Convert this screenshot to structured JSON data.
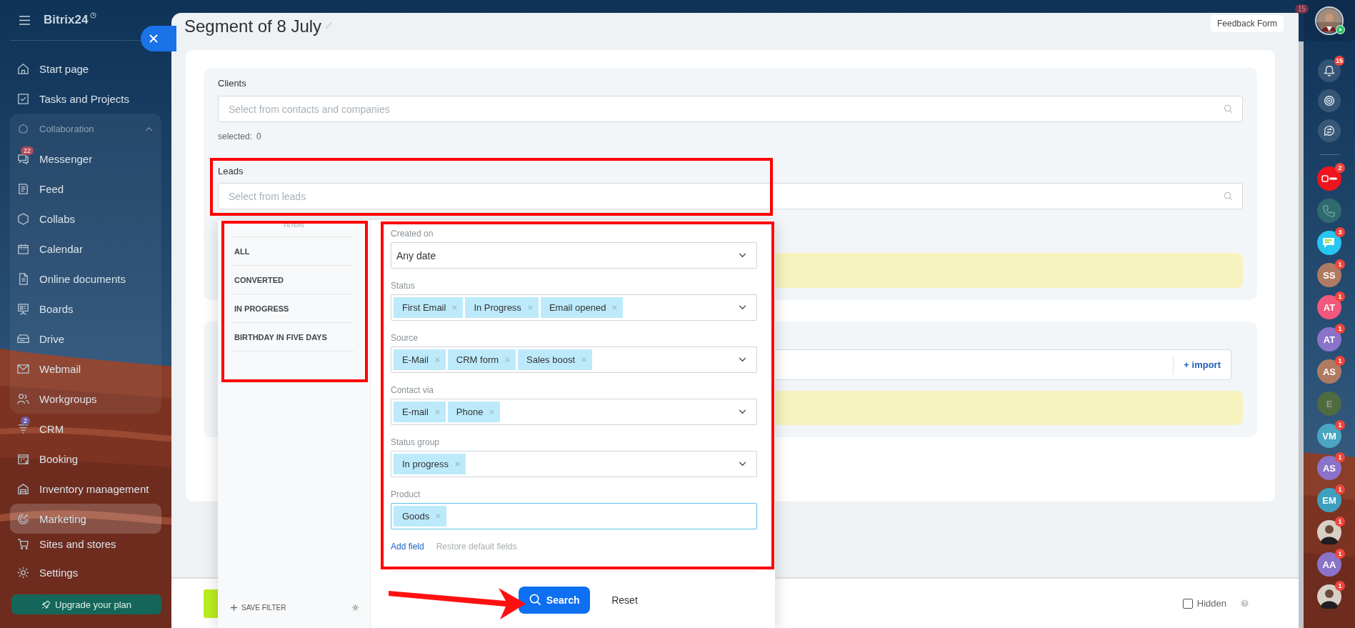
{
  "sidebar": {
    "logo": "Bitrix24",
    "items": [
      {
        "label": "Start page",
        "selected": false
      },
      {
        "label": "Tasks and Projects",
        "selected": false
      },
      {
        "label": "Collaboration",
        "selected": false,
        "expanded": true,
        "children": [
          {
            "label": "Messenger",
            "badge": "22",
            "selected": false
          },
          {
            "label": "Feed",
            "selected": false
          },
          {
            "label": "Collabs",
            "selected": false
          },
          {
            "label": "Calendar",
            "selected": false
          },
          {
            "label": "Online documents",
            "selected": false
          },
          {
            "label": "Boards",
            "selected": false
          },
          {
            "label": "Drive",
            "selected": false
          },
          {
            "label": "Webmail",
            "selected": false
          },
          {
            "label": "Workgroups",
            "selected": false
          }
        ]
      },
      {
        "label": "CRM",
        "badge": "2",
        "selected": false
      },
      {
        "label": "Booking",
        "selected": false
      },
      {
        "label": "Inventory management",
        "selected": false
      },
      {
        "label": "Marketing",
        "selected": true
      },
      {
        "label": "Sites and stores",
        "selected": false
      }
    ],
    "settings": "Settings",
    "upgrade_button": "Upgrade your plan"
  },
  "panel": {
    "title": "Segment of 8 July",
    "feedback_button": "Feedback Form",
    "clients": {
      "label": "Clients",
      "placeholder": "Select from contacts and companies",
      "selected_label": "selected:",
      "selected_count": "0"
    },
    "leads": {
      "label": "Leads",
      "placeholder": "Select from leads",
      "highlighted": true
    },
    "import_link": "+ import",
    "hidden_checkbox": {
      "label": "Hidden",
      "checked": false
    }
  },
  "filter_popup": {
    "heading": "FILTERS",
    "presets_highlighted": true,
    "presets": [
      {
        "label": "ALL",
        "selected": false
      },
      {
        "label": "CONVERTED",
        "selected": false
      },
      {
        "label": "IN PROGRESS",
        "selected": false
      },
      {
        "label": "BIRTHDAY IN FIVE DAYS",
        "selected": false
      }
    ],
    "save_filter": "SAVE FILTER",
    "fields_highlighted": true,
    "fields": [
      {
        "label": "Created on",
        "kind": "select",
        "value": "Any date",
        "focused": false
      },
      {
        "label": "Status",
        "kind": "multiselect",
        "tags": [
          "First Email",
          "In Progress",
          "Email opened"
        ],
        "focused": false
      },
      {
        "label": "Source",
        "kind": "multiselect",
        "tags": [
          "E-Mail",
          "CRM form",
          "Sales boost"
        ],
        "focused": false
      },
      {
        "label": "Contact via",
        "kind": "multiselect",
        "tags": [
          "E-mail",
          "Phone"
        ],
        "focused": false
      },
      {
        "label": "Status group",
        "kind": "multiselect",
        "tags": [
          "In progress"
        ],
        "focused": false
      },
      {
        "label": "Product",
        "kind": "entity",
        "tags": [
          "Goods"
        ],
        "focused": true
      }
    ],
    "add_field": "Add field",
    "restore_fields": "Restore default fields",
    "search_button": "Search",
    "search_arrow": true,
    "reset_button": "Reset"
  },
  "right_bar": {
    "top_badge": "15",
    "user_online": true,
    "tools": [
      {
        "kind": "bell",
        "badge": "15"
      },
      {
        "kind": "spiral"
      },
      {
        "kind": "chat"
      }
    ],
    "chats": [
      {
        "kind": "logo",
        "badge": "2"
      },
      {
        "kind": "call"
      },
      {
        "kind": "chat",
        "badge": "3"
      },
      {
        "kind": "initials",
        "initials": "SS",
        "color": "#b07a62",
        "badge": "1"
      },
      {
        "kind": "initials",
        "initials": "AT",
        "color": "#f2587c",
        "badge": "1"
      },
      {
        "kind": "initials",
        "initials": "AT",
        "color": "#8b73c9",
        "badge": "1"
      },
      {
        "kind": "initials",
        "initials": "AS",
        "color": "#b07a62",
        "badge": "1"
      },
      {
        "kind": "initials",
        "initials": "E",
        "color": "#4f6b40"
      },
      {
        "kind": "initials",
        "initials": "VM",
        "color": "#4aa5c2",
        "badge": "1"
      },
      {
        "kind": "initials",
        "initials": "AS",
        "color": "#8b73c9",
        "badge": "1"
      },
      {
        "kind": "initials",
        "initials": "EM",
        "color": "#3f9fbf",
        "badge": "1"
      },
      {
        "kind": "picture",
        "badge": "1"
      },
      {
        "kind": "initials",
        "initials": "AA",
        "color": "#8b73c9",
        "badge": "1"
      },
      {
        "kind": "picture",
        "badge": "1"
      }
    ]
  }
}
